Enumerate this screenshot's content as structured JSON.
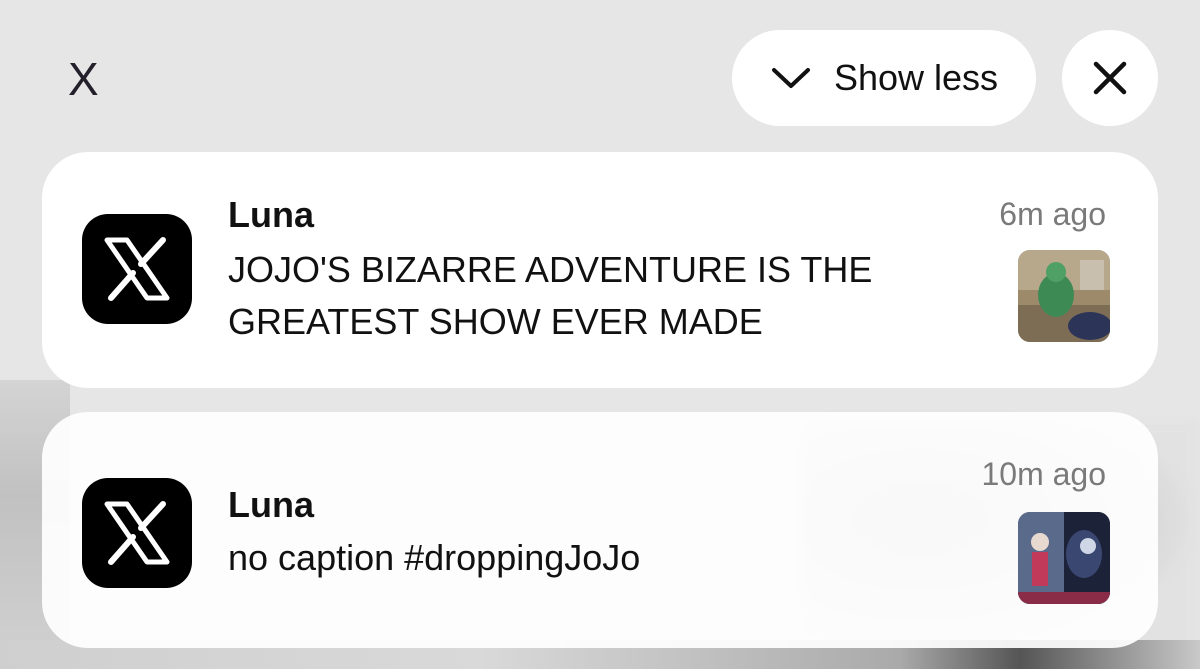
{
  "top_bar": {
    "app_label": "X",
    "show_less_label": "Show less",
    "close_icon": "close-icon",
    "chevron_icon": "chevron-down-icon"
  },
  "notifications": [
    {
      "sender": "Luna",
      "message": "JOJO'S BIZARRE ADVENTURE IS THE GREATEST SHOW EVER MADE",
      "time": "6m ago",
      "app_icon": "x-logo-icon",
      "thumbnail": "green-figure-photo-thumbnail"
    },
    {
      "sender": "Luna",
      "message": "no caption #droppingJoJo",
      "time": "10m ago",
      "app_icon": "x-logo-icon",
      "thumbnail": "anime-scene-thumbnail"
    }
  ],
  "colors": {
    "background": "#e6e6e6",
    "card": "#ffffff",
    "timestamp": "#7a7a7a",
    "icon_bg": "#000000"
  }
}
